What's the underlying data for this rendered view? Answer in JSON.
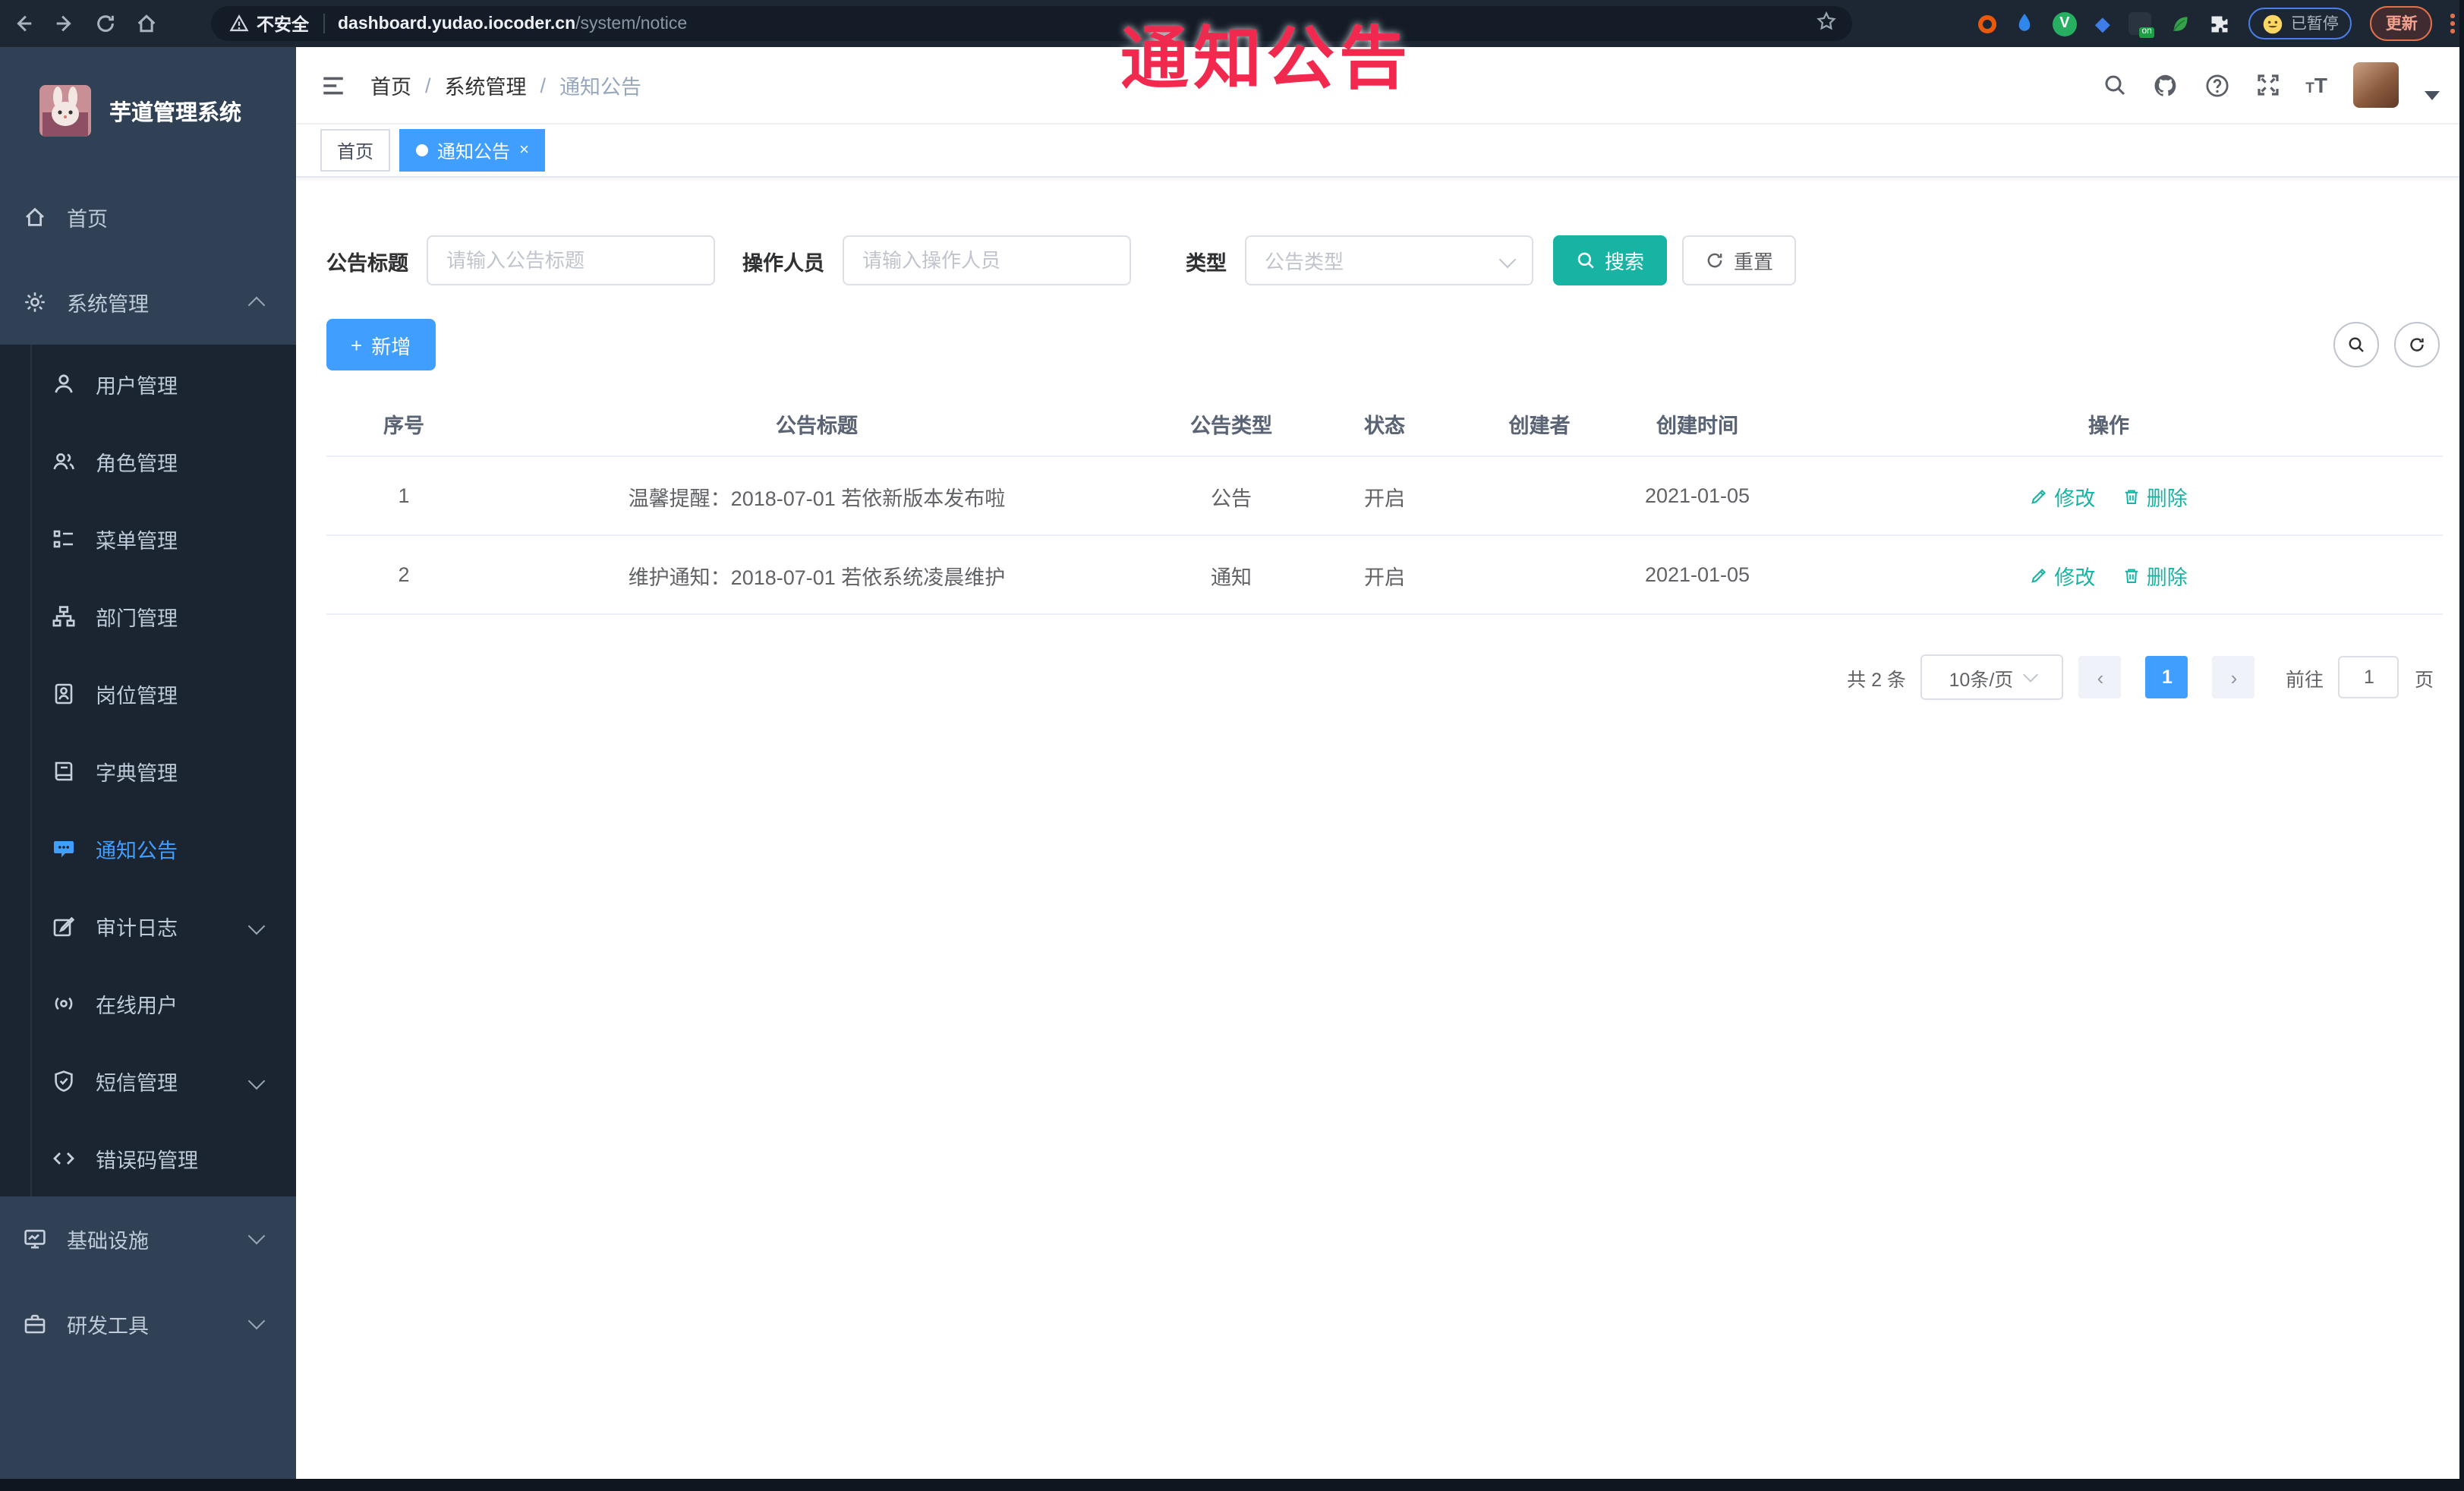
{
  "browser": {
    "security_label": "不安全",
    "url_host": "dashboard.yudao.iocoder.cn",
    "url_path": "/system/notice",
    "paused_label": "已暂停",
    "update_label": "更新",
    "on_badge_label": "on"
  },
  "overlay": {
    "text": "通知公告"
  },
  "sidebar": {
    "title": "芋道管理系统",
    "items": [
      {
        "label": "首页"
      },
      {
        "label": "系统管理"
      },
      {
        "label": "用户管理"
      },
      {
        "label": "角色管理"
      },
      {
        "label": "菜单管理"
      },
      {
        "label": "部门管理"
      },
      {
        "label": "岗位管理"
      },
      {
        "label": "字典管理"
      },
      {
        "label": "通知公告"
      },
      {
        "label": "审计日志"
      },
      {
        "label": "在线用户"
      },
      {
        "label": "短信管理"
      },
      {
        "label": "错误码管理"
      },
      {
        "label": "基础设施"
      },
      {
        "label": "研发工具"
      }
    ]
  },
  "header": {
    "breadcrumb": [
      "首页",
      "系统管理",
      "通知公告"
    ]
  },
  "tabs": {
    "items": [
      {
        "label": "首页"
      },
      {
        "label": "通知公告"
      }
    ]
  },
  "filters": {
    "title_label": "公告标题",
    "title_placeholder": "请输入公告标题",
    "operator_label": "操作人员",
    "operator_placeholder": "请输入操作人员",
    "type_label": "类型",
    "type_placeholder": "公告类型",
    "search_label": "搜索",
    "reset_label": "重置"
  },
  "toolbar": {
    "add_label": "新增"
  },
  "table": {
    "headers": [
      "序号",
      "公告标题",
      "公告类型",
      "状态",
      "创建者",
      "创建时间",
      "操作"
    ],
    "rows": [
      {
        "no": "1",
        "title": "温馨提醒：2018-07-01 若依新版本发布啦",
        "type": "公告",
        "status": "开启",
        "creator": "",
        "time": "2021-01-05",
        "edit": "修改",
        "delete": "删除"
      },
      {
        "no": "2",
        "title": "维护通知：2018-07-01 若依系统凌晨维护",
        "type": "通知",
        "status": "开启",
        "creator": "",
        "time": "2021-01-05",
        "edit": "修改",
        "delete": "删除"
      }
    ]
  },
  "pagination": {
    "total": "共 2 条",
    "page_size": "10条/页",
    "current_page": "1",
    "goto_label": "前往",
    "goto_value": "1",
    "unit_label": "页"
  },
  "colors": {
    "accent_blue": "#409eff",
    "accent_teal": "#17b3a3",
    "overlay_red": "#f2294e"
  }
}
